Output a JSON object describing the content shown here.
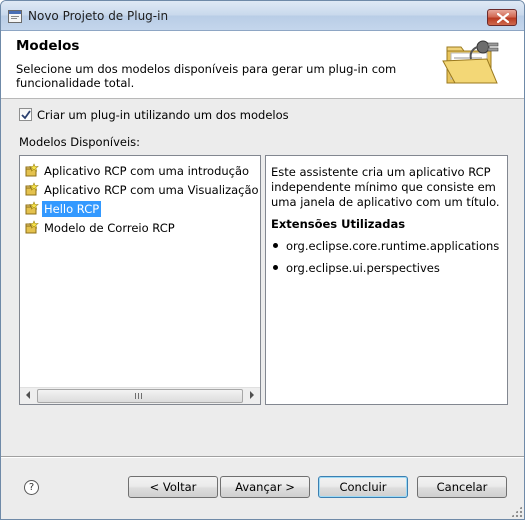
{
  "window": {
    "title": "Novo Projeto de Plug-in"
  },
  "banner": {
    "title": "Modelos",
    "description": "Selecione um dos modelos disponíveis para gerar um plug-in com funcionalidade total."
  },
  "checkbox": {
    "label": "Criar um plug-in utilizando um dos modelos",
    "checked": true
  },
  "templates": {
    "label": "Modelos Disponíveis:",
    "items": [
      {
        "label": "Aplicativo RCP com uma introdução"
      },
      {
        "label": "Aplicativo RCP com uma Visualização"
      },
      {
        "label": "Hello RCP",
        "selected": true
      },
      {
        "label": "Modelo de Correio RCP"
      }
    ]
  },
  "description": {
    "text": "Este assistente cria um aplicativo RCP independente mínimo que consiste em uma janela de aplicativo com um título.",
    "extensions_title": "Extensões Utilizadas",
    "extensions": [
      "org.eclipse.core.runtime.applications",
      "org.eclipse.ui.perspectives"
    ]
  },
  "buttons": {
    "help": "?",
    "back": "< Voltar",
    "next": "Avançar >",
    "finish": "Concluir",
    "cancel": "Cancelar"
  },
  "colors": {
    "selection": "#3399ff",
    "default_button_border": "#3c7fb1"
  }
}
